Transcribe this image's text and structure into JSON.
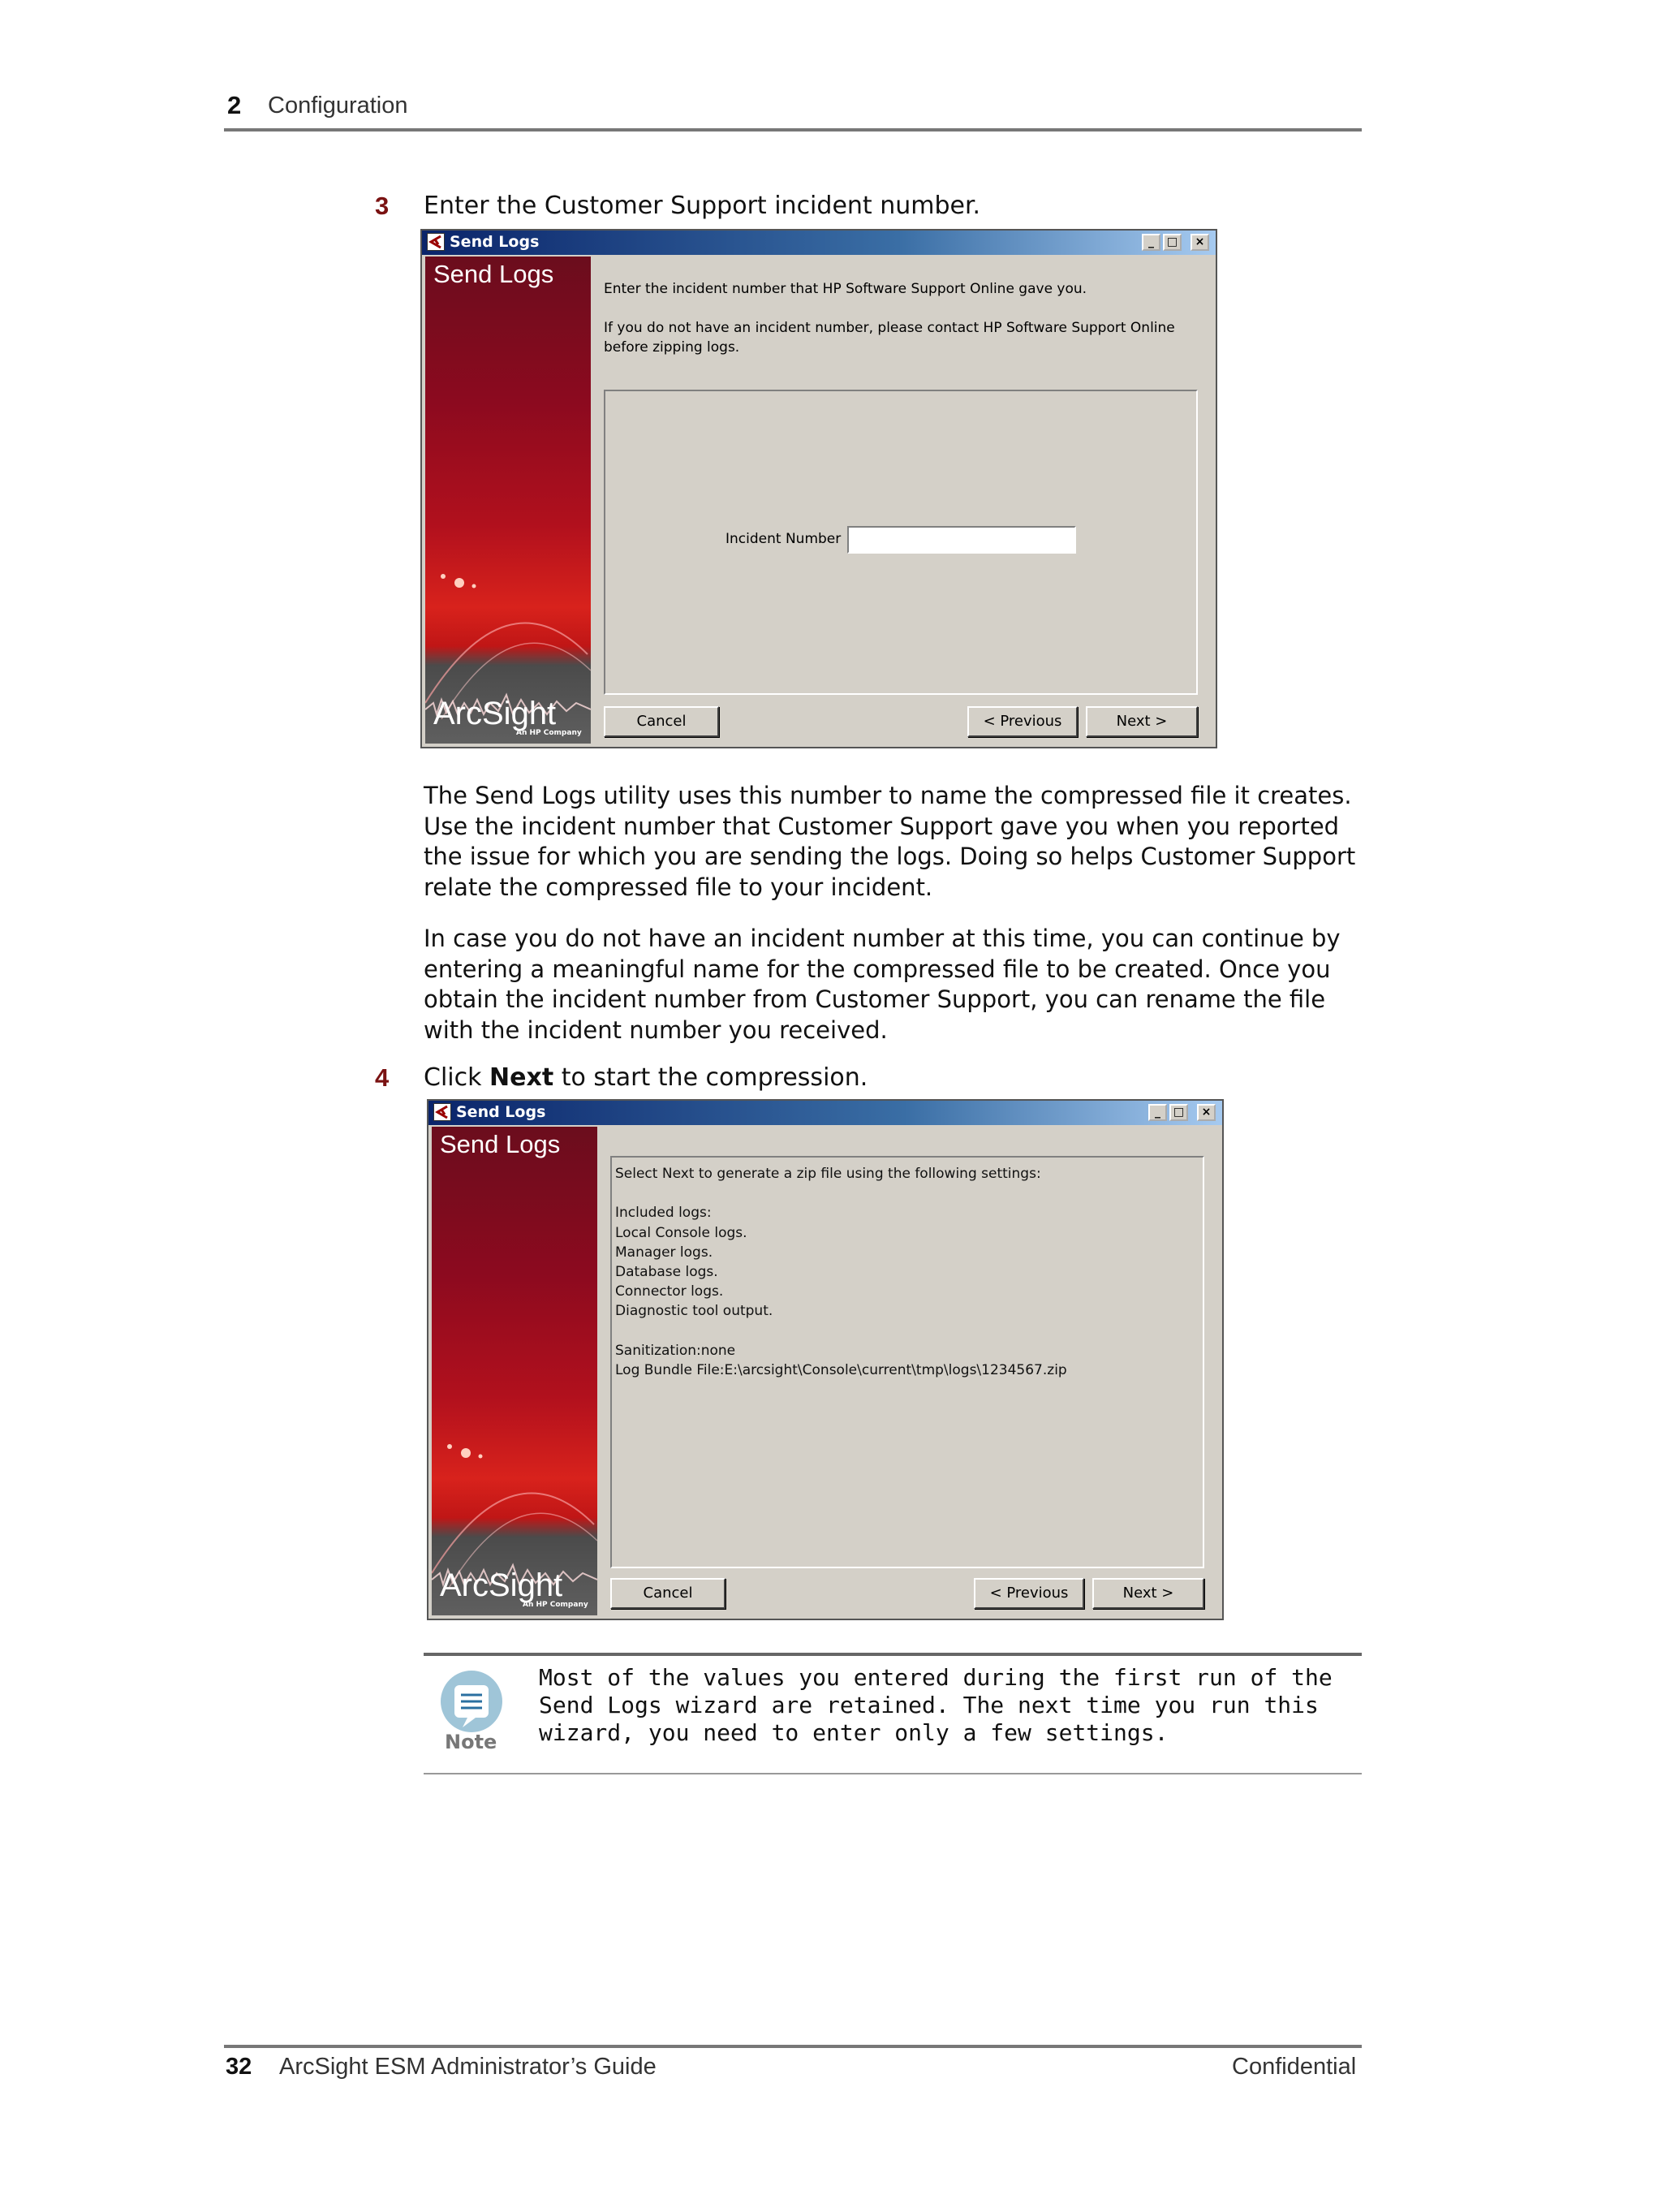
{
  "header": {
    "chapter_number": "2",
    "chapter_title": "Configuration"
  },
  "step3": {
    "number": "3",
    "text": "Enter the Customer Support incident number.",
    "dialog": {
      "title": "Send Logs",
      "side_title": "Send Logs",
      "logo": "ArcSight",
      "logo_sub": "An HP Company",
      "instruction1": "Enter the incident number that HP Software Support Online gave you.",
      "instruction2": "If you do not have an incident number, please contact HP Software Support Online",
      "instruction3": "before zipping logs.",
      "field_label": "Incident Number",
      "field_value": "",
      "cancel": "Cancel",
      "previous": "< Previous",
      "next": "Next >"
    },
    "paragraph1": "The Send Logs utility uses this number to name the compressed file it creates. Use the incident number that Customer Support gave you when you reported the issue for which you are sending the logs. Doing so helps Customer Support relate the compressed file to your incident.",
    "paragraph2": "In case you do not have an incident number at this time, you can continue by entering a meaningful name for the compressed file to be created. Once you obtain the incident number from Customer Support, you can rename the file with the incident number you received."
  },
  "step4": {
    "number": "4",
    "text_prefix": "Click ",
    "text_bold": "Next",
    "text_suffix": " to start the compression.",
    "dialog": {
      "title": "Send Logs",
      "side_title": "Send Logs",
      "logo": "ArcSight",
      "logo_sub": "An HP Company",
      "summary_lines": [
        "Select Next to generate a zip file using the following settings:",
        "",
        "Included logs:",
        "Local Console logs.",
        "Manager logs.",
        "Database logs.",
        "Connector logs.",
        "Diagnostic tool output.",
        "",
        "Sanitization:none",
        "Log Bundle File:E:\\arcsight\\Console\\current\\tmp\\logs\\1234567.zip"
      ],
      "cancel": "Cancel",
      "previous": "< Previous",
      "next": "Next >"
    }
  },
  "note": {
    "label": "Note",
    "text": "Most of the values you entered during the first run of the Send Logs wizard are retained. The next time you run this wizard, you need to enter only a few settings."
  },
  "footer": {
    "page_number": "32",
    "book_title": "ArcSight ESM Administrator’s Guide",
    "classification": "Confidential"
  }
}
